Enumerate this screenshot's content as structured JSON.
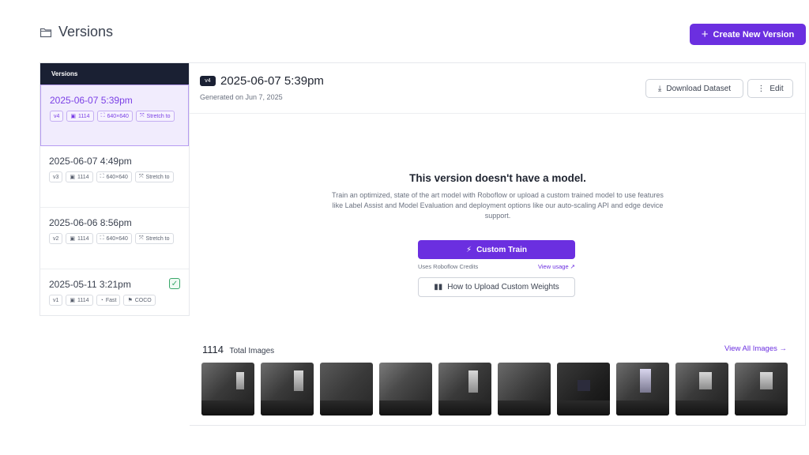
{
  "header": {
    "title": "Versions",
    "create_label": "Create New Version",
    "accent": "#6b2fe0"
  },
  "sidebar": {
    "title": "Versions",
    "versions": [
      {
        "date": "2025-06-07 5:39pm",
        "tag": "v4",
        "count": "1114",
        "size": "640×640",
        "transform": "Stretch to",
        "active": true
      },
      {
        "date": "2025-06-07 4:49pm",
        "tag": "v3",
        "count": "1114",
        "size": "640×640",
        "transform": "Stretch to",
        "active": false
      },
      {
        "date": "2025-06-06 8:56pm",
        "tag": "v2",
        "count": "1114",
        "size": "640×640",
        "transform": "Stretch to",
        "active": false
      },
      {
        "date": "2025-05-11 3:21pm",
        "tag": "v1",
        "count": "1114",
        "speed": "Fast",
        "format": "COCO",
        "active": false,
        "trained": true
      }
    ]
  },
  "main": {
    "badge": "v4",
    "title": "2025-06-07 5:39pm",
    "subtitle": "Generated on Jun 7, 2025",
    "download_label": "Download Dataset",
    "edit_label": "Edit",
    "empty_title": "This version doesn't have a model.",
    "empty_desc": "Train an optimized, state of the art model with Roboflow or upload a custom trained model to use features like Label Assist and Model Evaluation and deployment options like our auto-scaling API and edge device support.",
    "train_label": "Custom Train",
    "credits_text": "Uses Roboflow Credits",
    "view_usage": "View usage ↗",
    "weights_label": "How to Upload Custom Weights",
    "image_count": "1114",
    "images_label": "Total Images",
    "view_all": "View All Images →"
  }
}
